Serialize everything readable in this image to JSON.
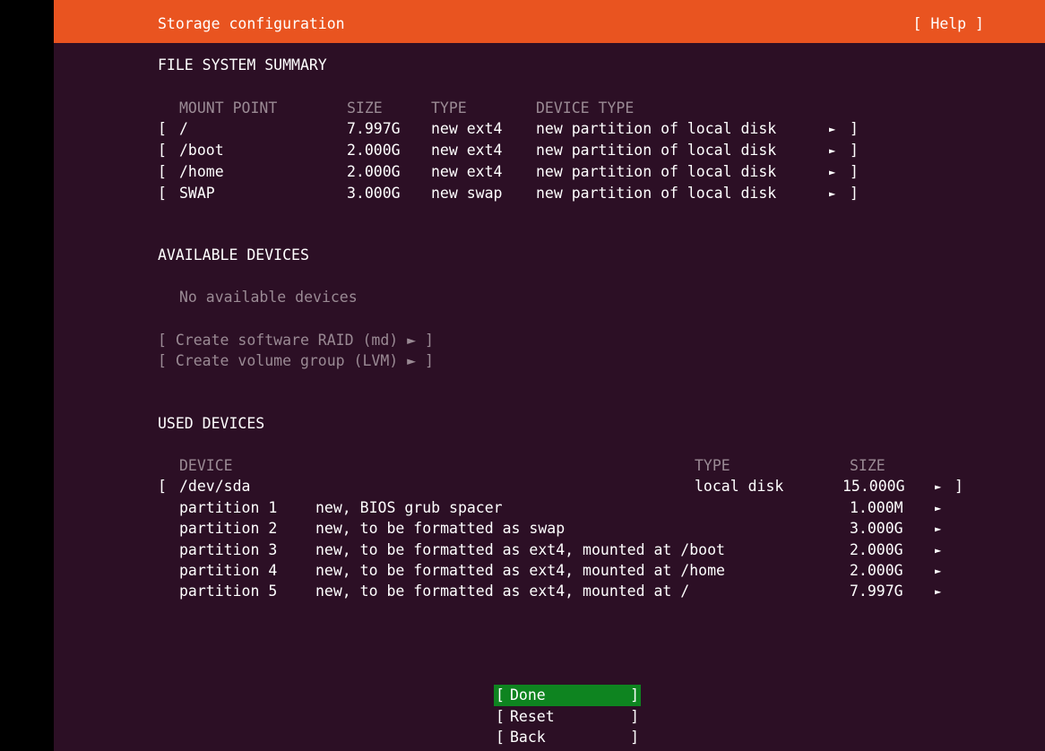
{
  "header": {
    "title": "Storage configuration",
    "help": "[ Help ]"
  },
  "fs_summary": {
    "heading": "FILE SYSTEM SUMMARY",
    "columns": {
      "mount_point": "MOUNT POINT",
      "size": "SIZE",
      "type": "TYPE",
      "device_type": "DEVICE TYPE"
    },
    "rows": [
      {
        "open": "[",
        "mount": "/",
        "size": "7.997G",
        "type": "new ext4",
        "device_type": "new partition of local disk",
        "arrow": "►",
        "close": "]"
      },
      {
        "open": "[",
        "mount": "/boot",
        "size": "2.000G",
        "type": "new ext4",
        "device_type": "new partition of local disk",
        "arrow": "►",
        "close": "]"
      },
      {
        "open": "[",
        "mount": "/home",
        "size": "2.000G",
        "type": "new ext4",
        "device_type": "new partition of local disk",
        "arrow": "►",
        "close": "]"
      },
      {
        "open": "[",
        "mount": "SWAP",
        "size": "3.000G",
        "type": "new swap",
        "device_type": "new partition of local disk",
        "arrow": "►",
        "close": "]"
      }
    ]
  },
  "available": {
    "heading": "AVAILABLE DEVICES",
    "empty": "No available devices",
    "actions": [
      "[ Create software RAID (md) ► ]",
      "[ Create volume group (LVM) ► ]"
    ]
  },
  "used": {
    "heading": "USED DEVICES",
    "columns": {
      "device": "DEVICE",
      "type": "TYPE",
      "size": "SIZE"
    },
    "disk": {
      "open": "[",
      "name": "/dev/sda",
      "type": "local disk",
      "size": "15.000G",
      "arrow": "►",
      "close": "]"
    },
    "partitions": [
      {
        "name": "partition 1",
        "desc": "new, BIOS grub spacer",
        "size": "1.000M",
        "arrow": "►"
      },
      {
        "name": "partition 2",
        "desc": "new, to be formatted as swap",
        "size": "3.000G",
        "arrow": "►"
      },
      {
        "name": "partition 3",
        "desc": "new, to be formatted as ext4, mounted at /boot",
        "size": "2.000G",
        "arrow": "►"
      },
      {
        "name": "partition 4",
        "desc": "new, to be formatted as ext4, mounted at /home",
        "size": "2.000G",
        "arrow": "►"
      },
      {
        "name": "partition 5",
        "desc": "new, to be formatted as ext4, mounted at /",
        "size": "7.997G",
        "arrow": "►"
      }
    ]
  },
  "buttons": [
    {
      "open": "[",
      "label": "Done",
      "close": "]"
    },
    {
      "open": "[",
      "label": "Reset",
      "close": "]"
    },
    {
      "open": "[",
      "label": "Back",
      "close": "]"
    }
  ],
  "colors": {
    "title_bar": "#e95420",
    "background": "#2c0f25",
    "selected_button": "#0e8420"
  }
}
